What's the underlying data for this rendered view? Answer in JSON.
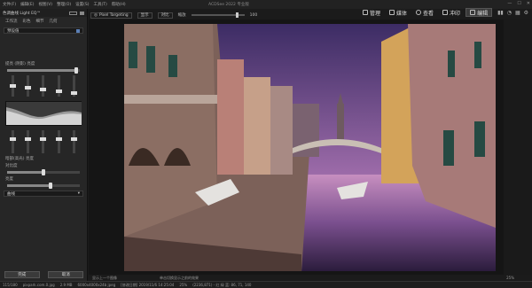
{
  "menu": {
    "items": [
      "文件(F)",
      "编辑(E)",
      "视图(V)",
      "整理(O)",
      "设置(S)",
      "工具(T)",
      "帮助(H)"
    ],
    "title": "ACDSee 2022 专业版"
  },
  "window_controls": [
    "—",
    "☐",
    "✕"
  ],
  "nav": {
    "manage": "管理",
    "photos": "媒体",
    "view": "查看",
    "develop": "冲印",
    "edit": "编辑"
  },
  "left_panel": {
    "header": "色调曲线 Light EQ™",
    "tabs": [
      "工作流",
      "彩色",
      "细节",
      "几何"
    ],
    "preset_label": "预设值",
    "slider1_label": "提亮 (阴影) 亮度",
    "slider1_fraction": 0.95,
    "curve_label": "暗部(高光) 亮度",
    "slider2_label": "对比度",
    "slider2_fraction": 0.5,
    "slider3_label": "亮度",
    "slider3_fraction": 0.6,
    "footer_label": "曲线",
    "done_button": "完成",
    "cancel_button": "取消"
  },
  "toolbar": {
    "pixel_targeting": "Pixel Targeting",
    "view_label": "显示",
    "compare_label": "对比",
    "zoom_label": "缩放",
    "zoom_value": "100"
  },
  "canvas_status": {
    "left": "显示上一个图像",
    "mid": "单击切换显示之前的效果",
    "zoom": "25%"
  },
  "status": {
    "page": "115/180",
    "filename": "pixpark.com.0.jpg",
    "size": "2.9 MB",
    "dims": "6000x4000x24b jpeg",
    "date": "[修改日期] 2019/11/6 14:25:04",
    "zoom": "25%",
    "coords": "(2236,871) - 红 绿 蓝: 86, 71, 140"
  },
  "colors": {
    "bg": "#1b1b1b",
    "panel": "#262626",
    "accent": "#5a5a5a"
  }
}
